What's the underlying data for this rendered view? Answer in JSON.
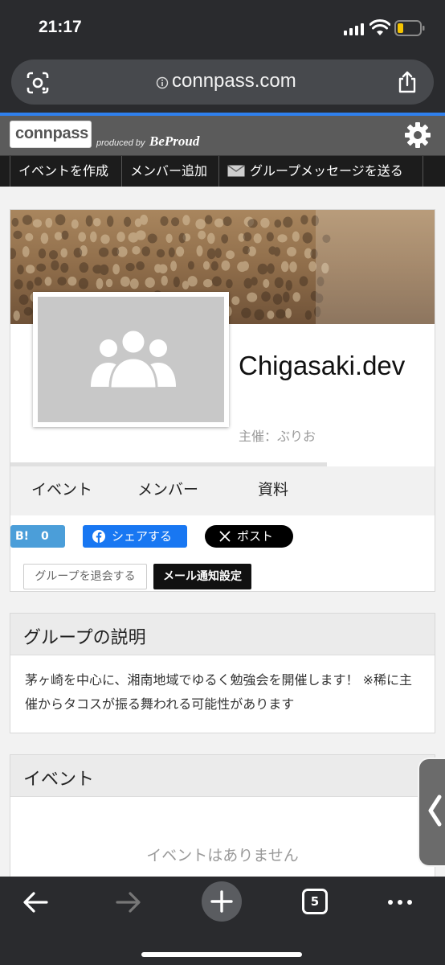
{
  "status_bar": {
    "time": "21:17"
  },
  "browser": {
    "url": "connpass.com",
    "tab_count": "5"
  },
  "header": {
    "logo": "connpass",
    "produced_by": "produced by",
    "brand": "BeProud"
  },
  "admin_menu": {
    "create_event": "イベントを作成",
    "add_member": "メンバー追加",
    "group_message": "グループメッセージを送る"
  },
  "group": {
    "name": "Chigasaki.dev",
    "organizer": "主催：ぶりお",
    "tabs": [
      "イベント",
      "メンバー",
      "資料"
    ],
    "hatena_label": "B!",
    "hatena_count": "0",
    "facebook_share": "シェアする",
    "x_post": "ポスト",
    "leave_button": "グループを退会する",
    "notify_button": "メール通知設定"
  },
  "description": {
    "heading": "グループの説明",
    "text": "茅ヶ崎を中心に、湘南地域でゆるく勉強会を開催します！ ※稀に主催からタコスが振る舞われる可能性があります"
  },
  "events": {
    "heading": "イベント",
    "empty_message": "イベントはありません"
  },
  "colors": {
    "browser_chrome": "#2a2b2e",
    "site_header": "#5b5b5b",
    "admin_menu": "#1c1c1c",
    "progress": "#2f80ed",
    "facebook": "#1877f2",
    "hatena": "#4b9ed9"
  }
}
